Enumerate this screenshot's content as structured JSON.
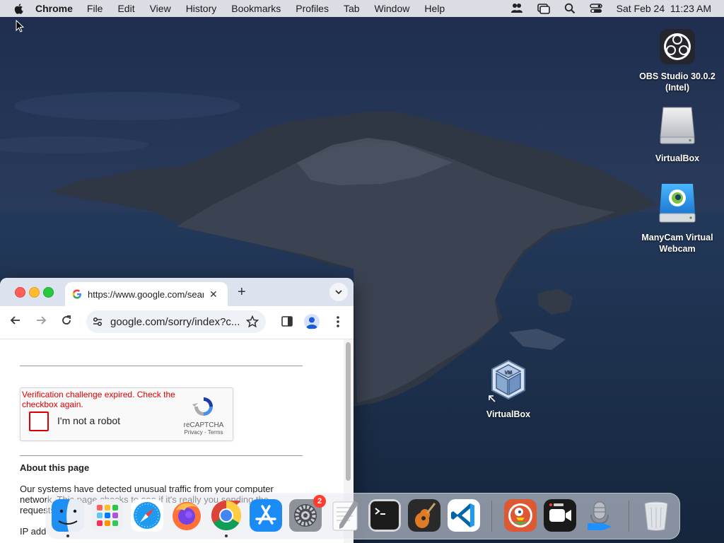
{
  "menubar": {
    "app_name": "Chrome",
    "items": [
      "File",
      "Edit",
      "View",
      "History",
      "Bookmarks",
      "Profiles",
      "Tab",
      "Window",
      "Help"
    ],
    "clock": "Sat Feb 24  11:23 AM"
  },
  "desktop": {
    "icons": [
      {
        "label": "OBS Studio 30.0.2 (Intel)",
        "icon": "obs-icon"
      },
      {
        "label": "VirtualBox",
        "icon": "drive-icon"
      },
      {
        "label": "ManyCam Virtual Webcam",
        "icon": "manycam-icon"
      },
      {
        "label": "VirtualBox",
        "icon": "virtualbox-icon"
      }
    ]
  },
  "browser": {
    "tab_title": "https://www.google.com/search",
    "omnibox_url": "google.com/sorry/index?c...",
    "page": {
      "recaptcha_error": "Verification challenge expired. Check the checkbox again.",
      "recaptcha_label": "I'm not a robot",
      "recaptcha_brand": "reCAPTCHA",
      "recaptcha_links": "Privacy - Terms",
      "about_title": "About this page",
      "about_text": "Our systems have detected unusual traffic from your computer network. This page checks to see if it's really you sending the requests",
      "ip_text": "IP add"
    }
  },
  "dock": {
    "apps": [
      {
        "name": "Finder",
        "running": true
      },
      {
        "name": "Launchpad",
        "running": false
      },
      {
        "name": "Safari",
        "running": false
      },
      {
        "name": "Firefox",
        "running": false
      },
      {
        "name": "Google Chrome",
        "running": true
      },
      {
        "name": "App Store",
        "running": false
      },
      {
        "name": "System Settings",
        "running": false,
        "badge": "2"
      },
      {
        "name": "TextEdit",
        "running": false
      },
      {
        "name": "Terminal",
        "running": false
      },
      {
        "name": "GarageBand",
        "running": false
      },
      {
        "name": "Visual Studio Code",
        "running": false
      },
      {
        "name": "DuckDuckGo",
        "running": false
      },
      {
        "name": "Screen Recorder",
        "running": false
      },
      {
        "name": "MP3 Recorder",
        "running": false
      },
      {
        "name": "Trash",
        "running": false
      }
    ]
  }
}
